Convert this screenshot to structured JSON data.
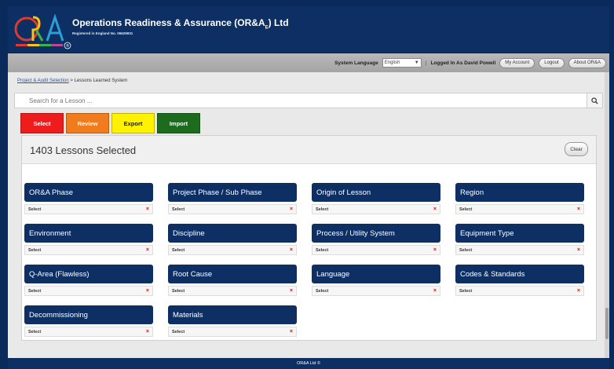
{
  "header": {
    "company_name": "Operations Readiness & Assurance (OR&A",
    "company_sub_suffix": "E",
    "company_name_end": ") Ltd",
    "registered": "Registered in England No. 06629931",
    "logo_text": "OR&A",
    "reg_mark": "®"
  },
  "topbar": {
    "system_language_label": "System Language",
    "language_value": "English",
    "logged_in": "Logged In As David Powell",
    "my_account": "My Account",
    "logout": "Logout",
    "about": "About OR&A"
  },
  "breadcrumb": {
    "link": "Project & Audit Selection",
    "separator": " > ",
    "current": "Lessons Learned System"
  },
  "search": {
    "placeholder": "Search for a Lesson ..."
  },
  "tabs": [
    {
      "label": "Select",
      "bg": "#ee1c1c",
      "fg": "#ffffff"
    },
    {
      "label": "Review",
      "bg": "#f07c1e",
      "fg": "#ffffff"
    },
    {
      "label": "Export",
      "bg": "#fff200",
      "fg": "#1a1a1a"
    },
    {
      "label": "Import",
      "bg": "#1d6b1d",
      "fg": "#ffffff"
    }
  ],
  "panel": {
    "count": "1403",
    "count_suffix": " Lessons Selected",
    "clear_label": "Clear"
  },
  "filters": [
    {
      "label": "OR&A Phase",
      "value": "Select"
    },
    {
      "label": "Project Phase / Sub Phase",
      "value": "Select"
    },
    {
      "label": "Origin of Lesson",
      "value": "Select"
    },
    {
      "label": "Region",
      "value": "Select"
    },
    {
      "label": "Environment",
      "value": "Select"
    },
    {
      "label": "Discipline",
      "value": "Select"
    },
    {
      "label": "Process / Utility System",
      "value": "Select"
    },
    {
      "label": "Equipment Type",
      "value": "Select"
    },
    {
      "label": "Q-Area (Flawless)",
      "value": "Select"
    },
    {
      "label": "Root Cause",
      "value": "Select"
    },
    {
      "label": "Language",
      "value": "Select"
    },
    {
      "label": "Codes & Standards",
      "value": "Select"
    },
    {
      "label": "Decommissioning",
      "value": "Select"
    },
    {
      "label": "Materials",
      "value": "Select"
    }
  ],
  "footer": {
    "text": "OR&A Ltd ©"
  },
  "colors": {
    "brand_navy": "#0e2f63",
    "outer_bg": "#0b2a5c"
  }
}
